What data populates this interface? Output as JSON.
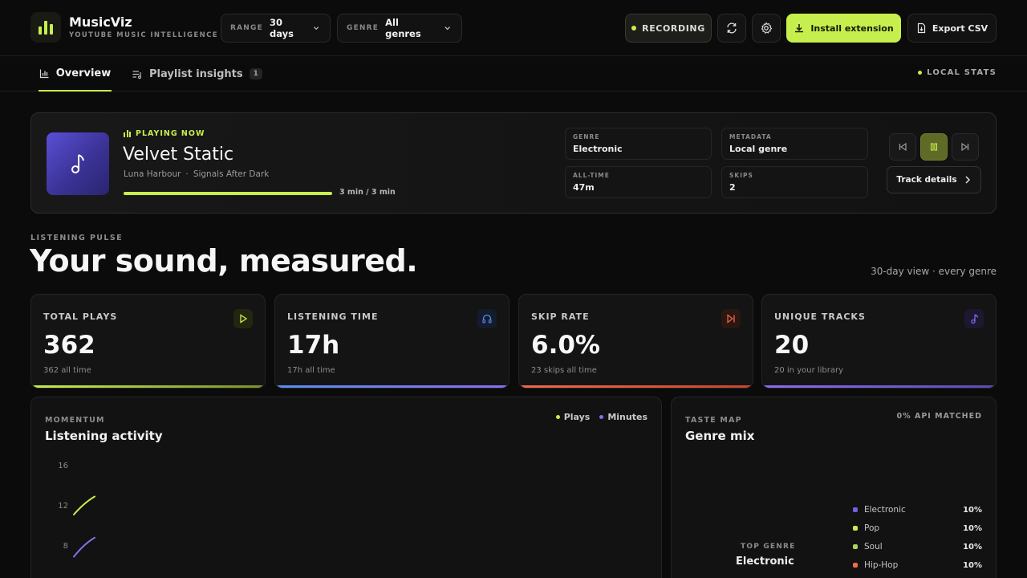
{
  "brand": {
    "name": "MusicViz",
    "subtitle": "YOUTUBE MUSIC INTELLIGENCE"
  },
  "filters": {
    "range": {
      "label": "RANGE",
      "value": "30 days"
    },
    "genre": {
      "label": "GENRE",
      "value": "All genres"
    }
  },
  "toolbar": {
    "recording_label": "RECORDING",
    "install_label": "Install extension",
    "export_label": "Export CSV"
  },
  "tabs": {
    "overview": "Overview",
    "playlist": "Playlist insights",
    "playlist_badge": "1",
    "local_stats": "LOCAL STATS"
  },
  "now_playing": {
    "label": "PLAYING NOW",
    "title": "Velvet Static",
    "artist": "Luna Harbour",
    "separator": "·",
    "album": "Signals After Dark",
    "progress_fraction": 1.0,
    "progress_text": "3 min / 3 min",
    "meta": {
      "genre_label": "GENRE",
      "genre_value": "Electronic",
      "metadata_label": "METADATA",
      "metadata_value": "Local genre",
      "alltime_label": "ALL-TIME",
      "alltime_value": "47m",
      "skips_label": "SKIPS",
      "skips_value": "2"
    },
    "details_label": "Track details"
  },
  "pulse": {
    "label": "LISTENING PULSE",
    "title": "Your sound, measured.",
    "view_text": "30-day view · every genre"
  },
  "stats": [
    {
      "label": "TOTAL PLAYS",
      "value": "362",
      "sub": "362 all time",
      "icon": "play-icon",
      "color": "#c6ef4e"
    },
    {
      "label": "LISTENING TIME",
      "value": "17h",
      "sub": "17h all time",
      "icon": "headphones-icon",
      "color": "#5b8def"
    },
    {
      "label": "SKIP RATE",
      "value": "6.0%",
      "sub": "23 skips all time",
      "icon": "skip-icon",
      "color": "#f06a4a"
    },
    {
      "label": "UNIQUE TRACKS",
      "value": "20",
      "sub": "20 in your library",
      "icon": "music-note-icon",
      "color": "#8b6cf0"
    }
  ],
  "activity": {
    "label": "MOMENTUM",
    "title": "Listening activity",
    "legend_plays": "Plays",
    "legend_minutes": "Minutes",
    "plays_color": "#c6ef4e",
    "minutes_color": "#8b6cf0",
    "yticks": [
      "16",
      "12",
      "8"
    ]
  },
  "genre_mix": {
    "label": "TASTE MAP",
    "title": "Genre mix",
    "api_text": "0% API MATCHED",
    "top_genre_label": "TOP GENRE",
    "top_genre": "Electronic",
    "items": [
      {
        "name": "Electronic",
        "pct": "10%",
        "color": "#6f62e8"
      },
      {
        "name": "Pop",
        "pct": "10%",
        "color": "#c6ef4e"
      },
      {
        "name": "Soul",
        "pct": "10%",
        "color": "#a6d65a"
      },
      {
        "name": "Hip-Hop",
        "pct": "10%",
        "color": "#f06a4a"
      }
    ]
  },
  "chart_data": {
    "type": "line",
    "title": "Listening activity",
    "xlabel": "",
    "ylabel": "",
    "yticks": [
      8,
      12,
      16
    ],
    "ylim": [
      6,
      18
    ],
    "series": [
      {
        "name": "Plays",
        "color": "#c6ef4e",
        "x": [
          1,
          2,
          3
        ],
        "values": [
          11.2,
          12.4,
          13.0
        ]
      },
      {
        "name": "Minutes",
        "color": "#8b6cf0",
        "x": [
          1,
          2,
          3
        ],
        "values": [
          7.0,
          8.3,
          8.9
        ]
      }
    ],
    "legend": "top-right",
    "grid": false
  }
}
